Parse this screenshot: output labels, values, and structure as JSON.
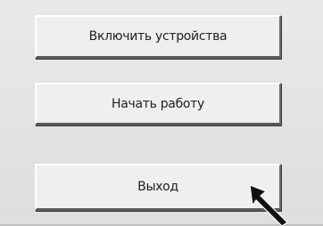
{
  "menu": {
    "enable_devices_label": "Включить устройства",
    "start_work_label": "Начать работу",
    "exit_label": "Выход"
  },
  "colors": {
    "background": "#e4e4e4",
    "button_face": "#efefef",
    "button_text": "#1f1f1f",
    "cursor": "#111111"
  },
  "cursor": {
    "icon": "arrow-pointer-icon"
  }
}
